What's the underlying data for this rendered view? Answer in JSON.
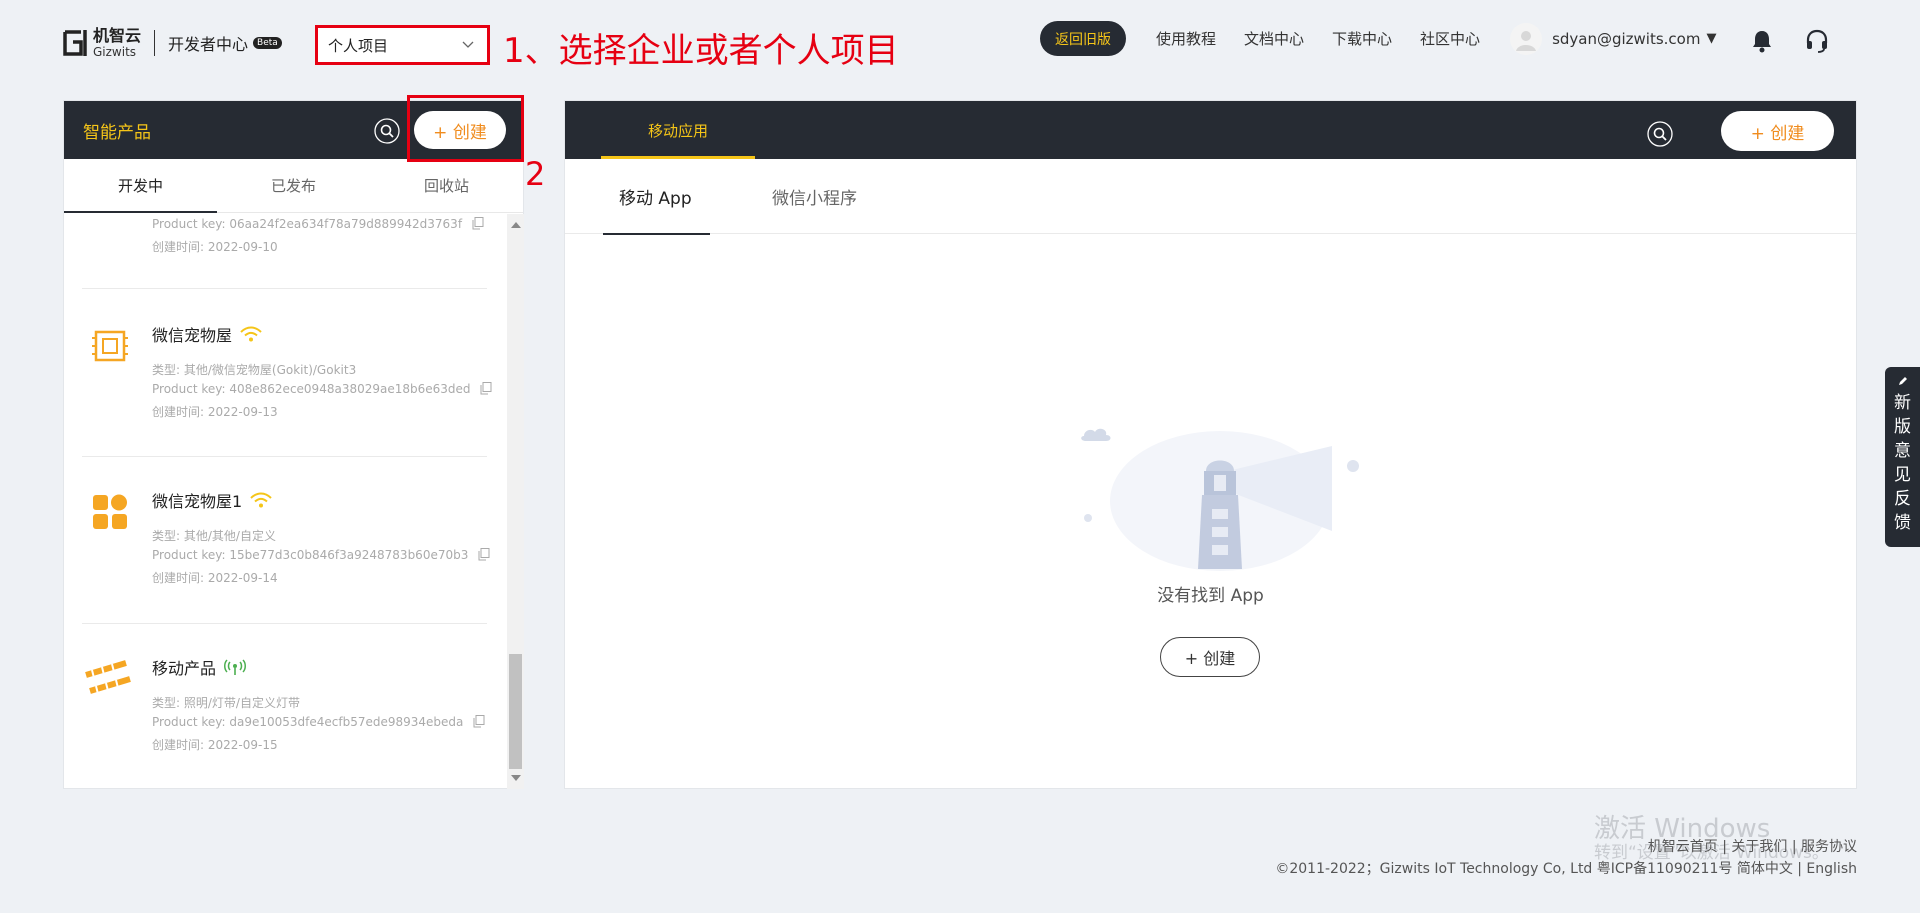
{
  "header": {
    "logo_cn": "机智云",
    "logo_en": "Gizwits",
    "dev_center": "开发者中心",
    "beta": "Beta",
    "project_select": "个人项目",
    "annotation_1": "1、选择企业或者个人项目",
    "annotation_2": "2",
    "old_version": "返回旧版",
    "nav": [
      "使用教程",
      "文档中心",
      "下载中心",
      "社区中心"
    ],
    "user_email": "sdyan@gizwits.com"
  },
  "left_panel": {
    "title": "智能产品",
    "create": "+ 创建",
    "tabs": [
      "开发中",
      "已发布",
      "回收站"
    ],
    "items": [
      {
        "name": "",
        "type": "",
        "product_key": "Product key: 06aa24f2ea634f78a79d889942d3763f",
        "created": "创建时间: 2022-09-10"
      },
      {
        "name": "微信宠物屋",
        "type": "类型: 其他/微信宠物屋(Gokit)/Gokit3",
        "product_key": "Product key: 408e862ece0948a38029ae18b6e63ded",
        "created": "创建时间: 2022-09-13"
      },
      {
        "name": "微信宠物屋1",
        "type": "类型: 其他/其他/自定义",
        "product_key": "Product key: 15be77d3c0b846f3a9248783b60e70b3",
        "created": "创建时间: 2022-09-14"
      },
      {
        "name": "移动产品",
        "type": "类型: 照明/灯带/自定义灯带",
        "product_key": "Product key: da9e10053dfe4ecfb57ede98934ebeda",
        "created": "创建时间: 2022-09-15"
      }
    ]
  },
  "right_panel": {
    "tab": "移动应用",
    "create": "+ 创建",
    "subtabs": [
      "移动 App",
      "微信小程序"
    ],
    "empty_text": "没有找到 App",
    "empty_create": "+ 创建"
  },
  "feedback": [
    "新",
    "版",
    "意",
    "见",
    "反",
    "馈"
  ],
  "footer": {
    "links": "机智云首页 | 关于我们 | 服务协议",
    "copyright": "©2011-2022；Gizwits IoT Technology Co, Ltd 粤ICP备11090211号 简体中文 | English",
    "watermark_1": "激活 Windows",
    "watermark_2": "转到“设置”以激活 Windows。"
  },
  "colors": {
    "dark": "#262b33",
    "accent_yellow": "#f5c518",
    "accent_orange": "#f08c1e",
    "annotation_red": "#e60012"
  }
}
